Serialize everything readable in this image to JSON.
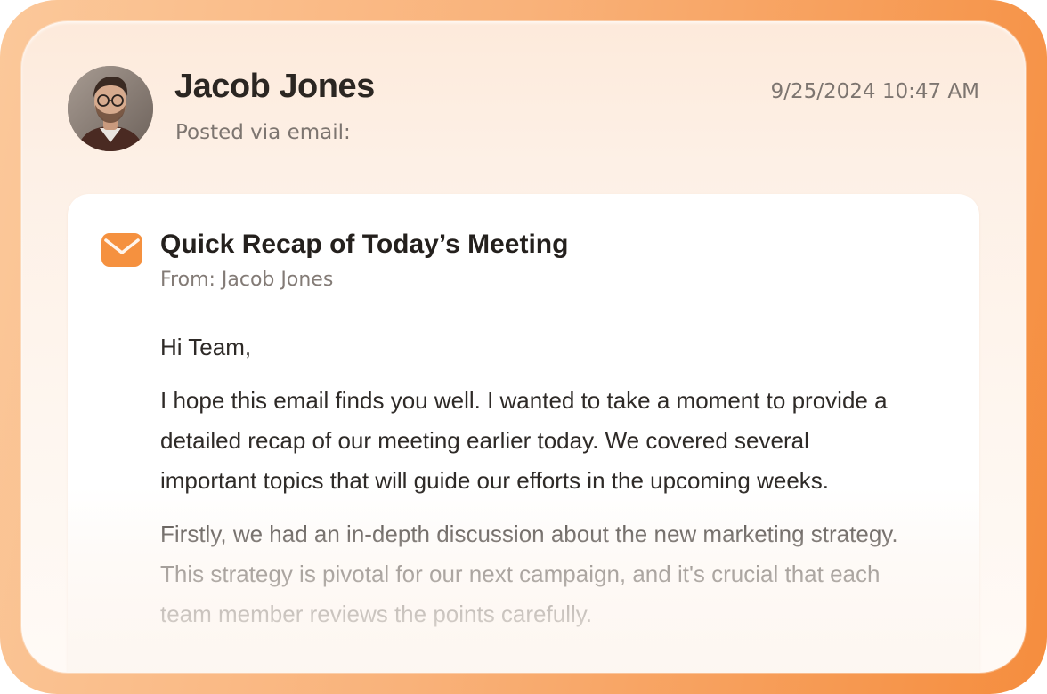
{
  "post": {
    "author_name": "Jacob Jones",
    "posted_via": "Posted via email:",
    "timestamp": "9/25/2024 10:47 AM"
  },
  "email": {
    "subject": "Quick Recap of Today’s Meeting",
    "from": "From: Jacob Jones",
    "greeting": "Hi Team,",
    "paragraphs": [
      "I hope this email finds you well. I wanted to take a moment to provide a detailed recap of our meeting earlier today. We covered several important topics that will guide our efforts in the upcoming weeks.",
      "Firstly, we had an in-depth discussion about the new marketing strategy. This strategy is pivotal for our next campaign, and it's crucial that each team member reviews the points carefully."
    ]
  },
  "icons": {
    "email_icon": "envelope-icon",
    "avatar": "avatar"
  },
  "colors": {
    "accent": "#f5913f",
    "frame_gradient_start": "#fbc89a",
    "frame_gradient_end": "#f58d3e"
  }
}
